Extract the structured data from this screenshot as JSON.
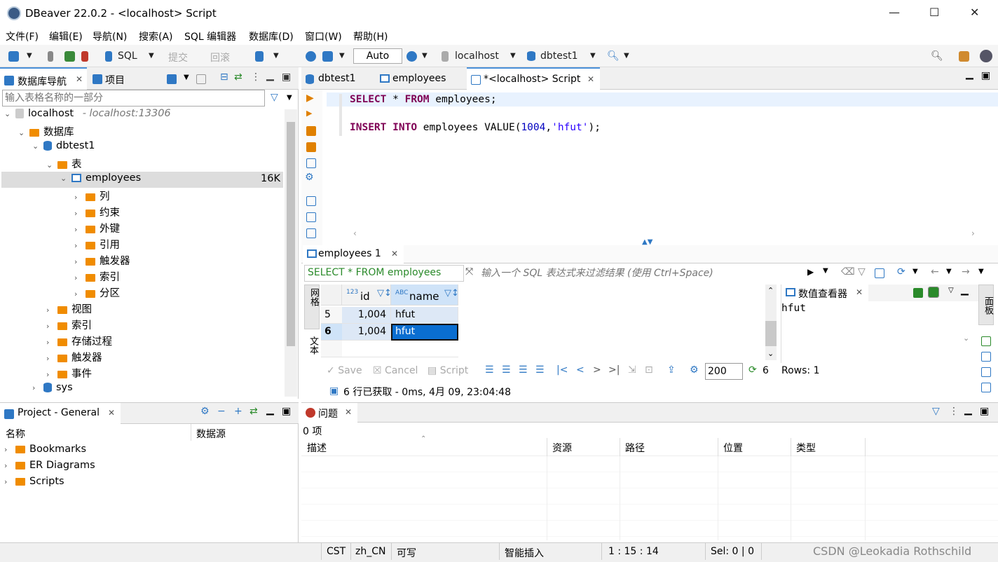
{
  "window": {
    "title": "DBeaver 22.0.2 - <localhost> Script",
    "minimize": "—",
    "maximize": "☐",
    "close": "✕"
  },
  "menu": [
    "文件(F)",
    "编辑(E)",
    "导航(N)",
    "搜索(A)",
    "SQL 编辑器",
    "数据库(D)",
    "窗口(W)",
    "帮助(H)"
  ],
  "toolbar": {
    "sql": "SQL",
    "commit": "提交",
    "rollback": "回滚",
    "txmode": "Auto",
    "connection": "localhost",
    "database": "dbtest1"
  },
  "navigator": {
    "tab_label": "数据库导航",
    "project_tab": "项目",
    "filter_placeholder": "输入表格名称的一部分",
    "connection": "localhost",
    "connection_info": "- localhost:13306",
    "databases": "数据库",
    "db": "dbtest1",
    "tables": "表",
    "table": "employees",
    "table_size": "16K",
    "table_children": [
      "列",
      "约束",
      "外键",
      "引用",
      "触发器",
      "索引",
      "分区"
    ],
    "db_children": [
      "视图",
      "索引",
      "存储过程",
      "触发器",
      "事件"
    ],
    "other_db": "sys"
  },
  "project": {
    "tab": "Project - General",
    "col_name": "名称",
    "col_source": "数据源",
    "items": [
      "Bookmarks",
      "ER Diagrams",
      "Scripts"
    ]
  },
  "editor": {
    "tabs": [
      "dbtest1",
      "employees",
      "*<localhost> Script"
    ]
  },
  "results": {
    "tab": "employees 1",
    "query": "SELECT * FROM employees",
    "filter_placeholder": "输入一个 SQL 表达式来过滤结果 (使用 Ctrl+Space)",
    "side_grid": "网格",
    "side_text": "文本",
    "columns": [
      {
        "type": "123",
        "name": "id"
      },
      {
        "type": "ABC",
        "name": "name"
      }
    ],
    "rows": [
      {
        "num": "5",
        "id": "1,004",
        "name": "hfut"
      },
      {
        "num": "6",
        "id": "1,004",
        "name": "hfut"
      }
    ],
    "save": "Save",
    "cancel": "Cancel",
    "script": "Script",
    "fetch_size": "200",
    "count": "6",
    "rows_label": "Rows: 1",
    "status": "6 行已获取 - 0ms, 4月 09, 23:04:48"
  },
  "value_viewer": {
    "tab": "数值查看器",
    "value": "hfut",
    "side_label": "面板"
  },
  "problems": {
    "tab": "问题",
    "count": "0 项",
    "columns": [
      "描述",
      "资源",
      "路径",
      "位置",
      "类型"
    ]
  },
  "statusbar": {
    "tz": "CST",
    "locale": "zh_CN",
    "mode": "可写",
    "insert": "智能插入",
    "pos": "1 : 15 : 14",
    "sel": "Sel: 0 | 0",
    "watermark": "CSDN @Leokadia Rothschild"
  }
}
